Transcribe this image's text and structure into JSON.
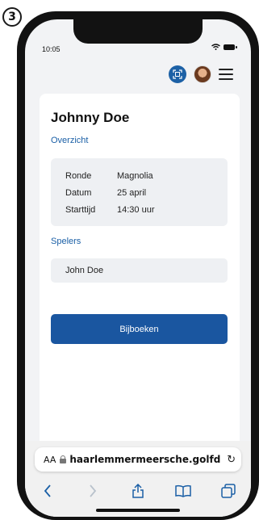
{
  "step": "3",
  "status": {
    "time": "10:05"
  },
  "profile": {
    "name": "Johnny Doe"
  },
  "overview": {
    "label": "Overzicht",
    "rows": [
      {
        "key": "Ronde",
        "value": "Magnolia"
      },
      {
        "key": "Datum",
        "value": "25 april"
      },
      {
        "key": "Starttijd",
        "value": "14:30 uur"
      }
    ]
  },
  "players": {
    "label": "Spelers",
    "items": [
      "John Doe"
    ]
  },
  "actions": {
    "book_label": "Bijboeken"
  },
  "browser": {
    "aa": "AA",
    "url": "haarlemmermeersche.golfd",
    "accent": "#1a5fa6"
  },
  "colors": {
    "primary_button": "#1a56a0",
    "section_label": "#1a5fa6",
    "scan_icon_bg": "#1d61a6"
  },
  "icons": [
    "wifi-icon",
    "battery-icon",
    "scan-icon",
    "avatar",
    "menu-icon",
    "lock-icon",
    "reload-icon",
    "back-icon",
    "forward-icon",
    "share-icon",
    "bookmarks-icon",
    "tabs-icon"
  ]
}
